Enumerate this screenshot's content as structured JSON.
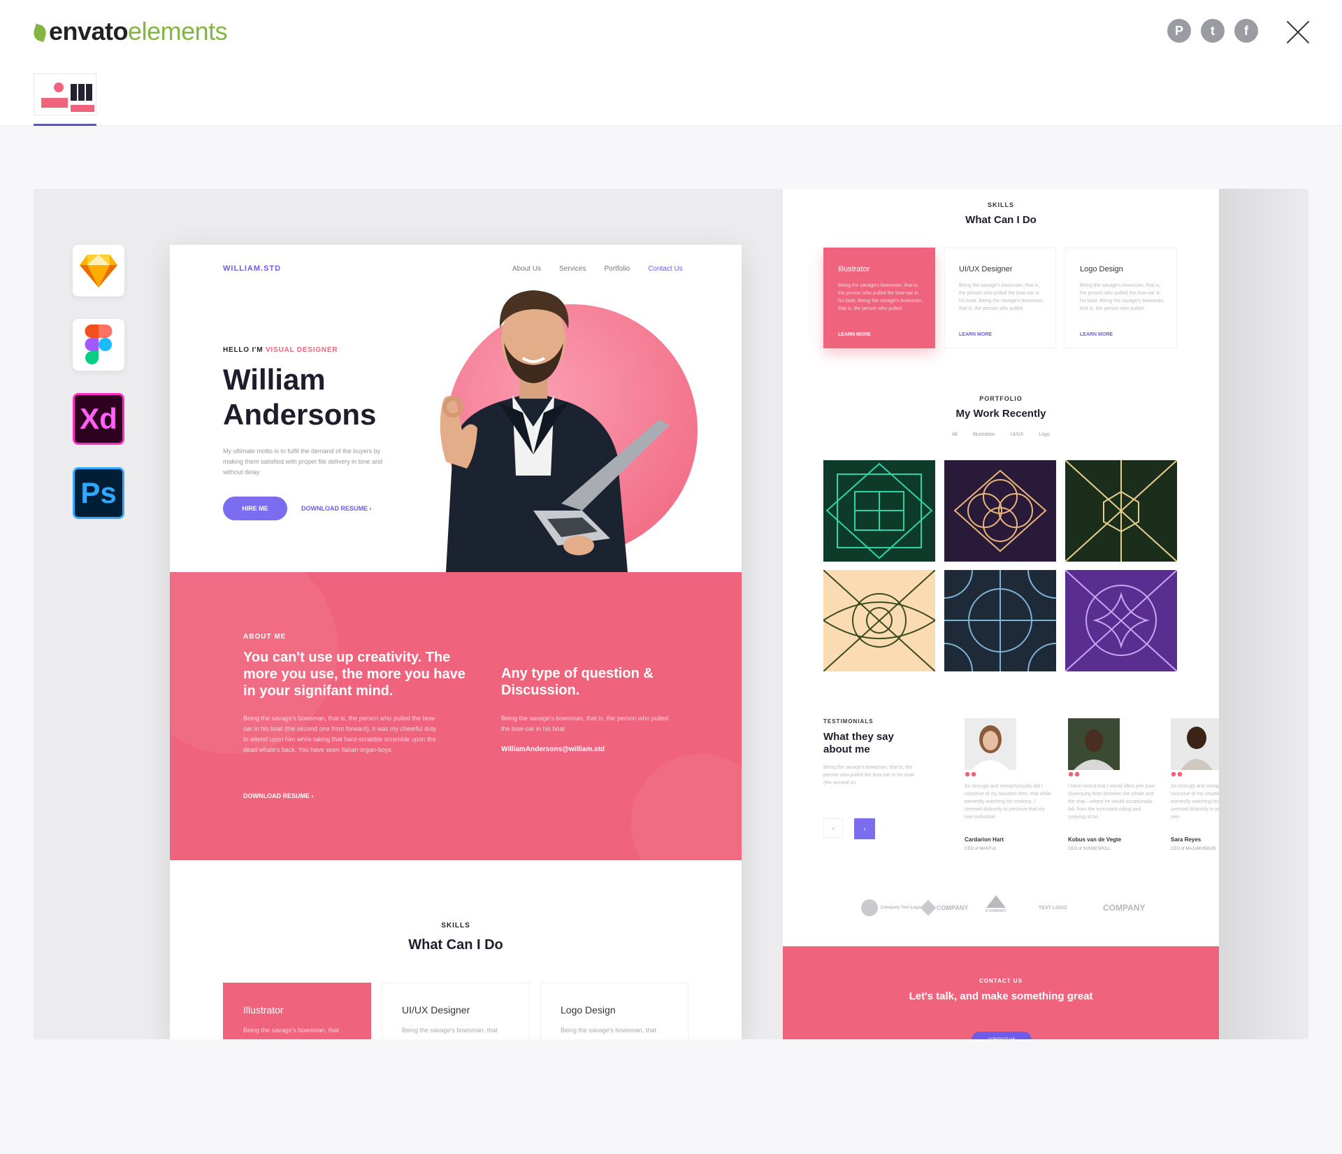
{
  "header": {
    "logo_part1": "envato",
    "logo_part2": "elements",
    "share": [
      {
        "icon": "pinterest-icon",
        "glyph": "P"
      },
      {
        "icon": "twitter-icon",
        "glyph": "t"
      },
      {
        "icon": "facebook-icon",
        "glyph": "f"
      }
    ]
  },
  "tools": [
    "sketch-icon",
    "figma-icon",
    "Xd",
    "Ps"
  ],
  "page1": {
    "brand": "WILLIAM.STD",
    "nav": [
      "About Us",
      "Services",
      "Portfolio",
      "Contact Us"
    ],
    "hello_prefix": "HELLO I'M ",
    "hello_accent": "VISUAL DESIGNER",
    "name": "William Andersons",
    "bio": "My ultimate motto is to fulfil the demand of the buyers by making them satisfied with proper file delivery in time and without delay",
    "hire": "HIRE ME",
    "download": "DOWNLOAD RESUME",
    "about_tag": "ABOUT ME",
    "about_heading": "You can't use up creativity. The more you use, the more you have in your signifant mind.",
    "about_body": "Being the savage's bowsman, that is, the person who pulled the bow-oar in his boat (the second one from forward), it was my cheerful duty to attend upon him while taking that hard-scrabble scramble upon the dead whale's back. You have seen Italian organ-boys",
    "about_download": "DOWNLOAD RESUME",
    "question_heading": "Any type of question & Discussion.",
    "question_body": "Being the savage's bowsman, that is, the person who pulled the bow-oar in his boat",
    "email": "WilliamAndersons@william.std",
    "skills_tag": "SKILLS",
    "skills_heading": "What Can I Do",
    "skills": [
      {
        "title": "Illustrator",
        "body": "Being the savage's bowsman, that"
      },
      {
        "title": "UI/UX Designer",
        "body": "Being the savage's bowsman, that"
      },
      {
        "title": "Logo Design",
        "body": "Being the savage's bowsman, that"
      }
    ]
  },
  "page2": {
    "skills_tag": "SKILLS",
    "skills_heading": "What Can I Do",
    "skill_cards": [
      {
        "title": "Illustrator",
        "body": "Being the savage's bowsman, that is, the person who pulled the bow-oar in his boat. Being the savage's bowsman, that is, the person who pulled",
        "more": "LEARN MORE"
      },
      {
        "title": "UI/UX Designer",
        "body": "Being the savage's bowsman, that is, the person who pulled the bow-oar in his boat. Being the savage's bowsman, that is, the person who pulled",
        "more": "LEARN MORE"
      },
      {
        "title": "Logo Design",
        "body": "Being the savage's bowsman, that is, the person who pulled the bow-oar in his boat. Being the savage's bowsman, that is, the person who pulled",
        "more": "LEARN MORE"
      }
    ],
    "portfolio_tag": "PORTFOLIO",
    "portfolio_heading": "My Work Recently",
    "filters": [
      "All",
      "Illustration",
      "UI/UX",
      "Logo"
    ],
    "testimonials_tag": "TESTIMONIALS",
    "testimonials_heading": "What they say about me",
    "testimonials_body": "Being the savage's bowsman, that is, the person who pulled the bow-oar in his boat (the second on",
    "people": [
      {
        "name": "Cardarion Hart",
        "role": "CEO of MANTUL",
        "quote": "So strongly and metaphysically did I conceive of my situation then, that while earnestly watching his motions, I seemed distinctly to perceive that my own individual"
      },
      {
        "name": "Kobus van de Vegte",
        "role": "CEO of SUNSESPOLL",
        "quote": "I have hinted that I would often jerk poor Queequeg from between the whale and the ship—where he would occasionally fall, from the incessant rolling and swaying of bo"
      },
      {
        "name": "Sara Reyes",
        "role": "CEO of MAJUMUNDUR",
        "quote": "So strongly and metaphysically did I conceive of my situation then, that while earnestly watching his motions, I seemed distinctly to perceive that my own"
      }
    ],
    "brands": [
      "Company Text Logo",
      "COMPANY",
      "A COMPANY",
      "TEXT LOGO",
      "COMPANY"
    ],
    "contact_tag": "CONTACT US",
    "contact_heading": "Let's talk, and make something great",
    "contact_button": "CONTACT US"
  }
}
